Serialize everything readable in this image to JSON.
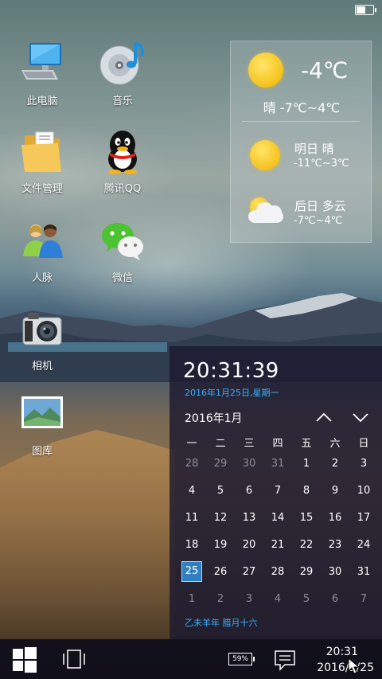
{
  "desktop": {
    "icons": [
      {
        "label": "此电脑",
        "icon": "computer-icon"
      },
      {
        "label": "音乐",
        "icon": "music-icon"
      },
      {
        "label": "文件管理",
        "icon": "folder-icon"
      },
      {
        "label": "腾讯QQ",
        "icon": "qq-icon"
      },
      {
        "label": "人脉",
        "icon": "contacts-icon"
      },
      {
        "label": "微信",
        "icon": "wechat-icon"
      },
      {
        "label": "相机",
        "icon": "camera-icon"
      },
      {
        "label": "图库",
        "icon": "gallery-icon"
      }
    ]
  },
  "weather": {
    "today_temp": "-4℃",
    "today_summary": "晴 -7℃~4℃",
    "tomorrow_label": "明日 晴",
    "tomorrow_range": "-11℃~3℃",
    "dayafter_label": "后日 多云",
    "dayafter_range": "-7℃~4℃",
    "colors": {
      "sun": "#f5c21a",
      "cloud": "#f1f3f4"
    }
  },
  "calendar": {
    "time": "20:31:39",
    "date_line": "2016年1月25日,星期一",
    "month_label": "2016年1月",
    "weekdays": [
      "一",
      "二",
      "三",
      "四",
      "五",
      "六",
      "日"
    ],
    "weeks": [
      [
        "28",
        "29",
        "30",
        "31",
        "1",
        "2",
        "3"
      ],
      [
        "4",
        "5",
        "6",
        "7",
        "8",
        "9",
        "10"
      ],
      [
        "11",
        "12",
        "13",
        "14",
        "15",
        "16",
        "17"
      ],
      [
        "18",
        "19",
        "20",
        "21",
        "22",
        "23",
        "24"
      ],
      [
        "25",
        "26",
        "27",
        "28",
        "29",
        "30",
        "31"
      ],
      [
        "1",
        "2",
        "3",
        "4",
        "5",
        "6",
        "7"
      ]
    ],
    "today": "25",
    "lunar": "乙未羊年  腊月十六",
    "accent": "#3ab0ff"
  },
  "taskbar": {
    "battery": "59%",
    "time": "20:31",
    "date": "2016/1/25"
  }
}
